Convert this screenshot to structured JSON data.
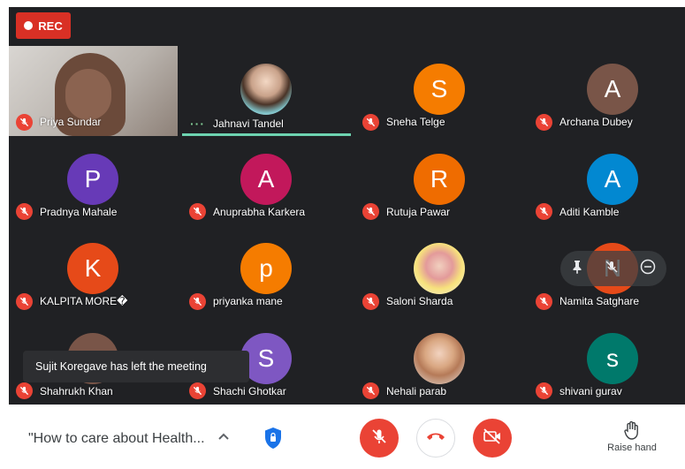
{
  "recording": {
    "label": "REC"
  },
  "participants": [
    {
      "name": "Priya Sundar",
      "type": "video"
    },
    {
      "name": "Jahnavi Tandel",
      "type": "photo",
      "speaking": true
    },
    {
      "name": "Sneha Telge",
      "initial": "S",
      "color": "#f57c00"
    },
    {
      "name": "Archana Dubey",
      "initial": "A",
      "color": "#795548"
    },
    {
      "name": "Pradnya Mahale",
      "initial": "P",
      "color": "#673ab7"
    },
    {
      "name": "Anuprabha Karkera",
      "initial": "A",
      "color": "#c2185b"
    },
    {
      "name": "Rutuja Pawar",
      "initial": "R",
      "color": "#ef6c00"
    },
    {
      "name": "Aditi Kamble",
      "initial": "A",
      "color": "#0288d1"
    },
    {
      "name": "KALPITA MORE�",
      "initial": "K",
      "color": "#e64a19"
    },
    {
      "name": "priyanka mane",
      "initial": "p",
      "color": "#f57c00"
    },
    {
      "name": "Saloni Sharda",
      "type": "photo"
    },
    {
      "name": "Namita Satghare",
      "initial": "N",
      "color": "#e64a19"
    },
    {
      "name": "Shahrukh Khan",
      "initial": "",
      "color": "#795548"
    },
    {
      "name": "Shachi Ghotkar",
      "initial": "S",
      "color": "#7e57c2"
    },
    {
      "name": "Nehali parab",
      "type": "photo"
    },
    {
      "name": "shivani gurav",
      "initial": "s",
      "color": "#00796b"
    }
  ],
  "toast": {
    "message": "Sujit Koregave has left the meeting"
  },
  "bottom": {
    "meeting_title": "\"How to care about Health...",
    "raise_hand_label": "Raise hand"
  },
  "icons": {
    "mic_off": "mic-off-icon",
    "hangup": "hangup-icon",
    "cam_off": "camera-off-icon",
    "pin": "pin-icon",
    "remove": "remove-icon",
    "shield": "shield-icon",
    "chevron": "chevron-up-icon",
    "hand": "raise-hand-icon"
  }
}
